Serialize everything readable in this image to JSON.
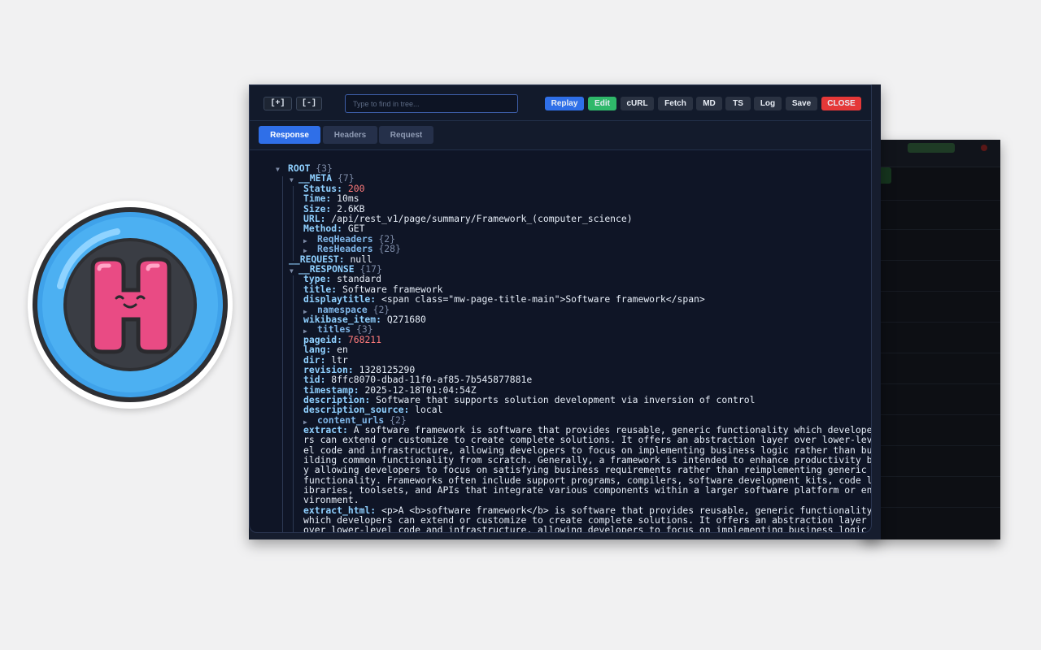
{
  "toolbar": {
    "expand_label": "[+]",
    "collapse_label": "[-]",
    "search_placeholder": "Type to find in tree...",
    "buttons": [
      {
        "label": "Replay"
      },
      {
        "label": "Edit"
      },
      {
        "label": "cURL"
      },
      {
        "label": "Fetch"
      },
      {
        "label": "MD"
      },
      {
        "label": "TS"
      },
      {
        "label": "Log"
      },
      {
        "label": "Save"
      },
      {
        "label": "CLOSE"
      }
    ]
  },
  "tabs": [
    {
      "label": "Response"
    },
    {
      "label": "Headers"
    },
    {
      "label": "Request"
    }
  ],
  "tree": {
    "root_key": "ROOT",
    "root_count": "{3}",
    "meta_key": "__META",
    "meta_count": "{7}",
    "status_key": "Status:",
    "status_val": "200",
    "time_key": "Time:",
    "time_val": "10ms",
    "size_key": "Size:",
    "size_val": "2.6KB",
    "url_key": "URL:",
    "url_val": "/api/rest_v1/page/summary/Framework_(computer_science)",
    "method_key": "Method:",
    "method_val": "GET",
    "reqheaders_key": "ReqHeaders",
    "reqheaders_count": "{2}",
    "resheaders_key": "ResHeaders",
    "resheaders_count": "{28}",
    "request_key": "__REQUEST:",
    "request_val": "null",
    "response_key": "__RESPONSE",
    "response_count": "{17}",
    "type_key": "type:",
    "type_val": "standard",
    "title_key": "title:",
    "title_val": "Software framework",
    "displaytitle_key": "displaytitle:",
    "displaytitle_val": "<span class=\"mw-page-title-main\">Software framework</span>",
    "namespace_key": "namespace",
    "namespace_count": "{2}",
    "wikibase_key": "wikibase_item:",
    "wikibase_val": "Q271680",
    "titles_key": "titles",
    "titles_count": "{3}",
    "pageid_key": "pageid:",
    "pageid_val": "768211",
    "lang_key": "lang:",
    "lang_val": "en",
    "dir_key": "dir:",
    "dir_val": "ltr",
    "revision_key": "revision:",
    "revision_val": "1328125290",
    "tid_key": "tid:",
    "tid_val": "8ffc8070-dbad-11f0-af85-7b545877881e",
    "timestamp_key": "timestamp:",
    "timestamp_val": "2025-12-18T01:04:54Z",
    "description_key": "description:",
    "description_val": "Software that supports solution development via inversion of control",
    "description_source_key": "description_source:",
    "description_source_val": "local",
    "content_urls_key": "content_urls",
    "content_urls_count": "{2}",
    "extract_key": "extract:",
    "extract_lines": [
      "A software framework is software that provides reusable, generic functionality which develope",
      "rs can extend or customize to create complete solutions. It offers an abstraction layer over lower-lev",
      "el code and infrastructure, allowing developers to focus on implementing business logic rather than bu",
      "ilding common functionality from scratch. Generally, a framework is intended to enhance productivity b",
      "y allowing developers to focus on satisfying business requirements rather than reimplementing generic",
      "functionality. Frameworks often include support programs, compilers, software development kits, code l",
      "ibraries, toolsets, and APIs that integrate various components within a larger software platform or en",
      "vironment."
    ],
    "extract_html_key": "extract_html:",
    "extract_html_lines": [
      "<p>A <b>software framework</b> is software that provides reusable, generic functionality",
      "which developers can extend or customize to create complete solutions. It offers an abstraction layer",
      "over lower-level code and infrastructure, allowing developers to focus on implementing business logic"
    ]
  },
  "colors": {
    "accent_blue": "#2f6fe8",
    "edit_green": "#2fb86a",
    "close_red": "#e53838",
    "number_red": "#ff7b7b",
    "key_blue": "#8fd0ff"
  }
}
